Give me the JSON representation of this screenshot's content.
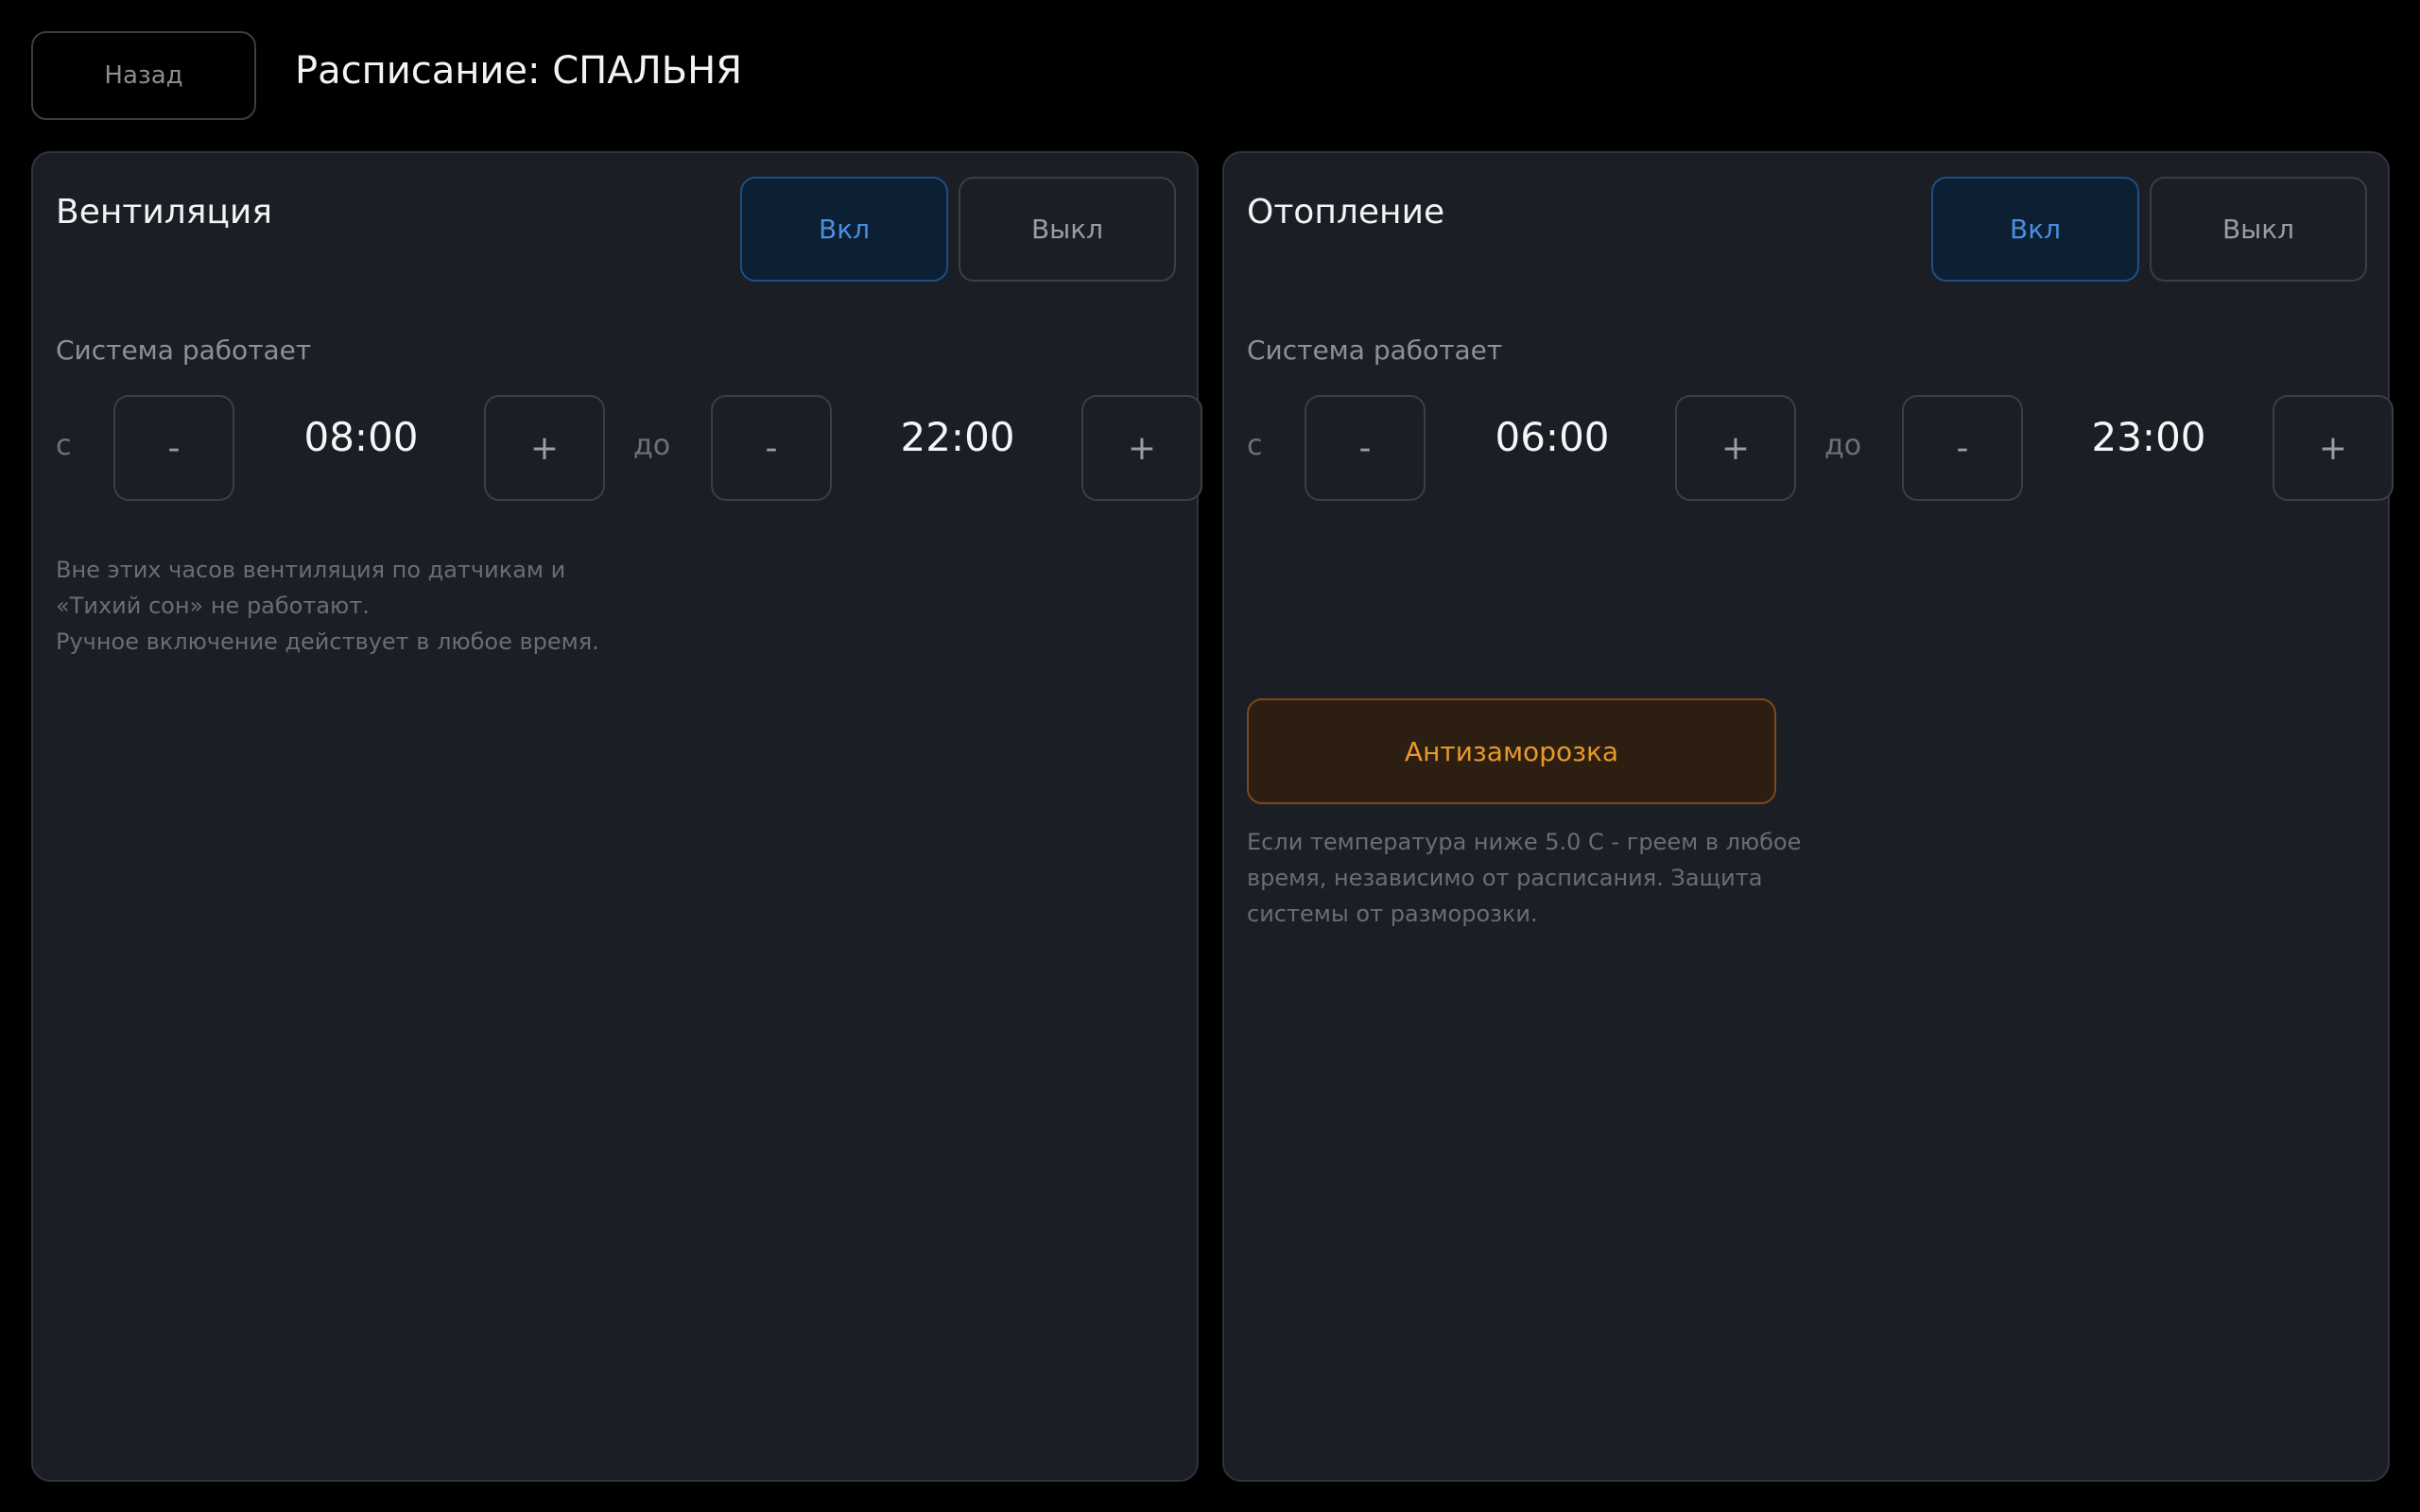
{
  "header": {
    "back_label": "Назад",
    "title": "Расписание: СПАЛЬНЯ"
  },
  "ventilation": {
    "title": "Вентиляция",
    "on_label": "Вкл",
    "off_label": "Выкл",
    "system_label": "Система работает",
    "from_label": "с",
    "to_label": "до",
    "minus_label": "-",
    "plus_label": "+",
    "from_time": "08:00",
    "to_time": "22:00",
    "note_line1": "Вне этих часов вентиляция по датчикам и",
    "note_line2": "«Тихий сон» не работают.",
    "note_line3": "Ручное включение действует в любое время."
  },
  "heating": {
    "title": "Отопление",
    "on_label": "Вкл",
    "off_label": "Выкл",
    "system_label": "Система работает",
    "from_label": "с",
    "to_label": "до",
    "minus_label": "-",
    "plus_label": "+",
    "from_time": "06:00",
    "to_time": "23:00",
    "antifreeze_label": "Антизаморозка",
    "note_line1": "Если температура ниже 5.0 С - греем в любое",
    "note_line2": "время, независимо от расписания. Защита",
    "note_line3": "системы от разморозки."
  },
  "colors": {
    "background": "#000000",
    "panel": "#1b1e25",
    "accent_on": "#4a8ee0",
    "antifreeze": "#e9982b"
  }
}
